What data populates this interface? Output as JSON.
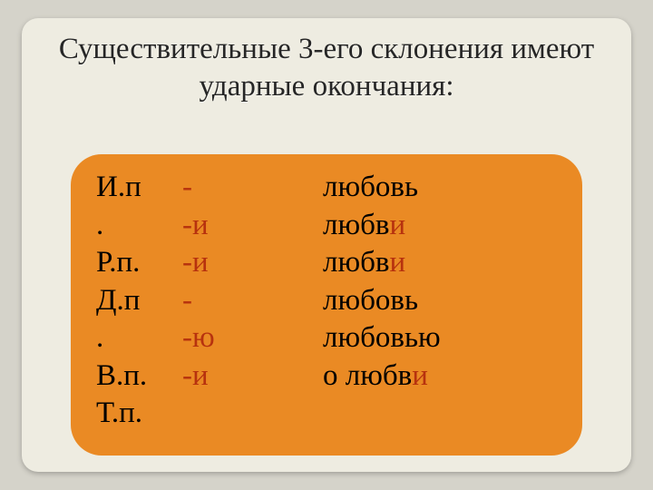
{
  "title": "Существительные 3-его склонения имеют ударные окончания:",
  "rows": [
    {
      "case_line1": "И.п",
      "case_line2": ".",
      "ending": "-",
      "word_stem": "любовь",
      "word_suffix": ""
    },
    {
      "case_line1": "Р.п.",
      "case_line2": "",
      "ending": "-и",
      "word_stem": "любв",
      "word_suffix": "и"
    },
    {
      "case_line1": "Д.п",
      "case_line2": ".",
      "ending": "-и",
      "word_stem": "любв",
      "word_suffix": "и"
    },
    {
      "case_line1": "В.п.",
      "case_line2": "",
      "ending": "-",
      "word_stem": "любовь",
      "word_suffix": ""
    },
    {
      "case_line1": "Т.п.",
      "case_line2": "",
      "ending": "-ю",
      "word_stem": "любовью",
      "word_suffix": ""
    },
    {
      "case_line1": "",
      "case_line2": "",
      "ending": "-и",
      "word_stem": "о любв",
      "word_suffix": "и"
    }
  ]
}
